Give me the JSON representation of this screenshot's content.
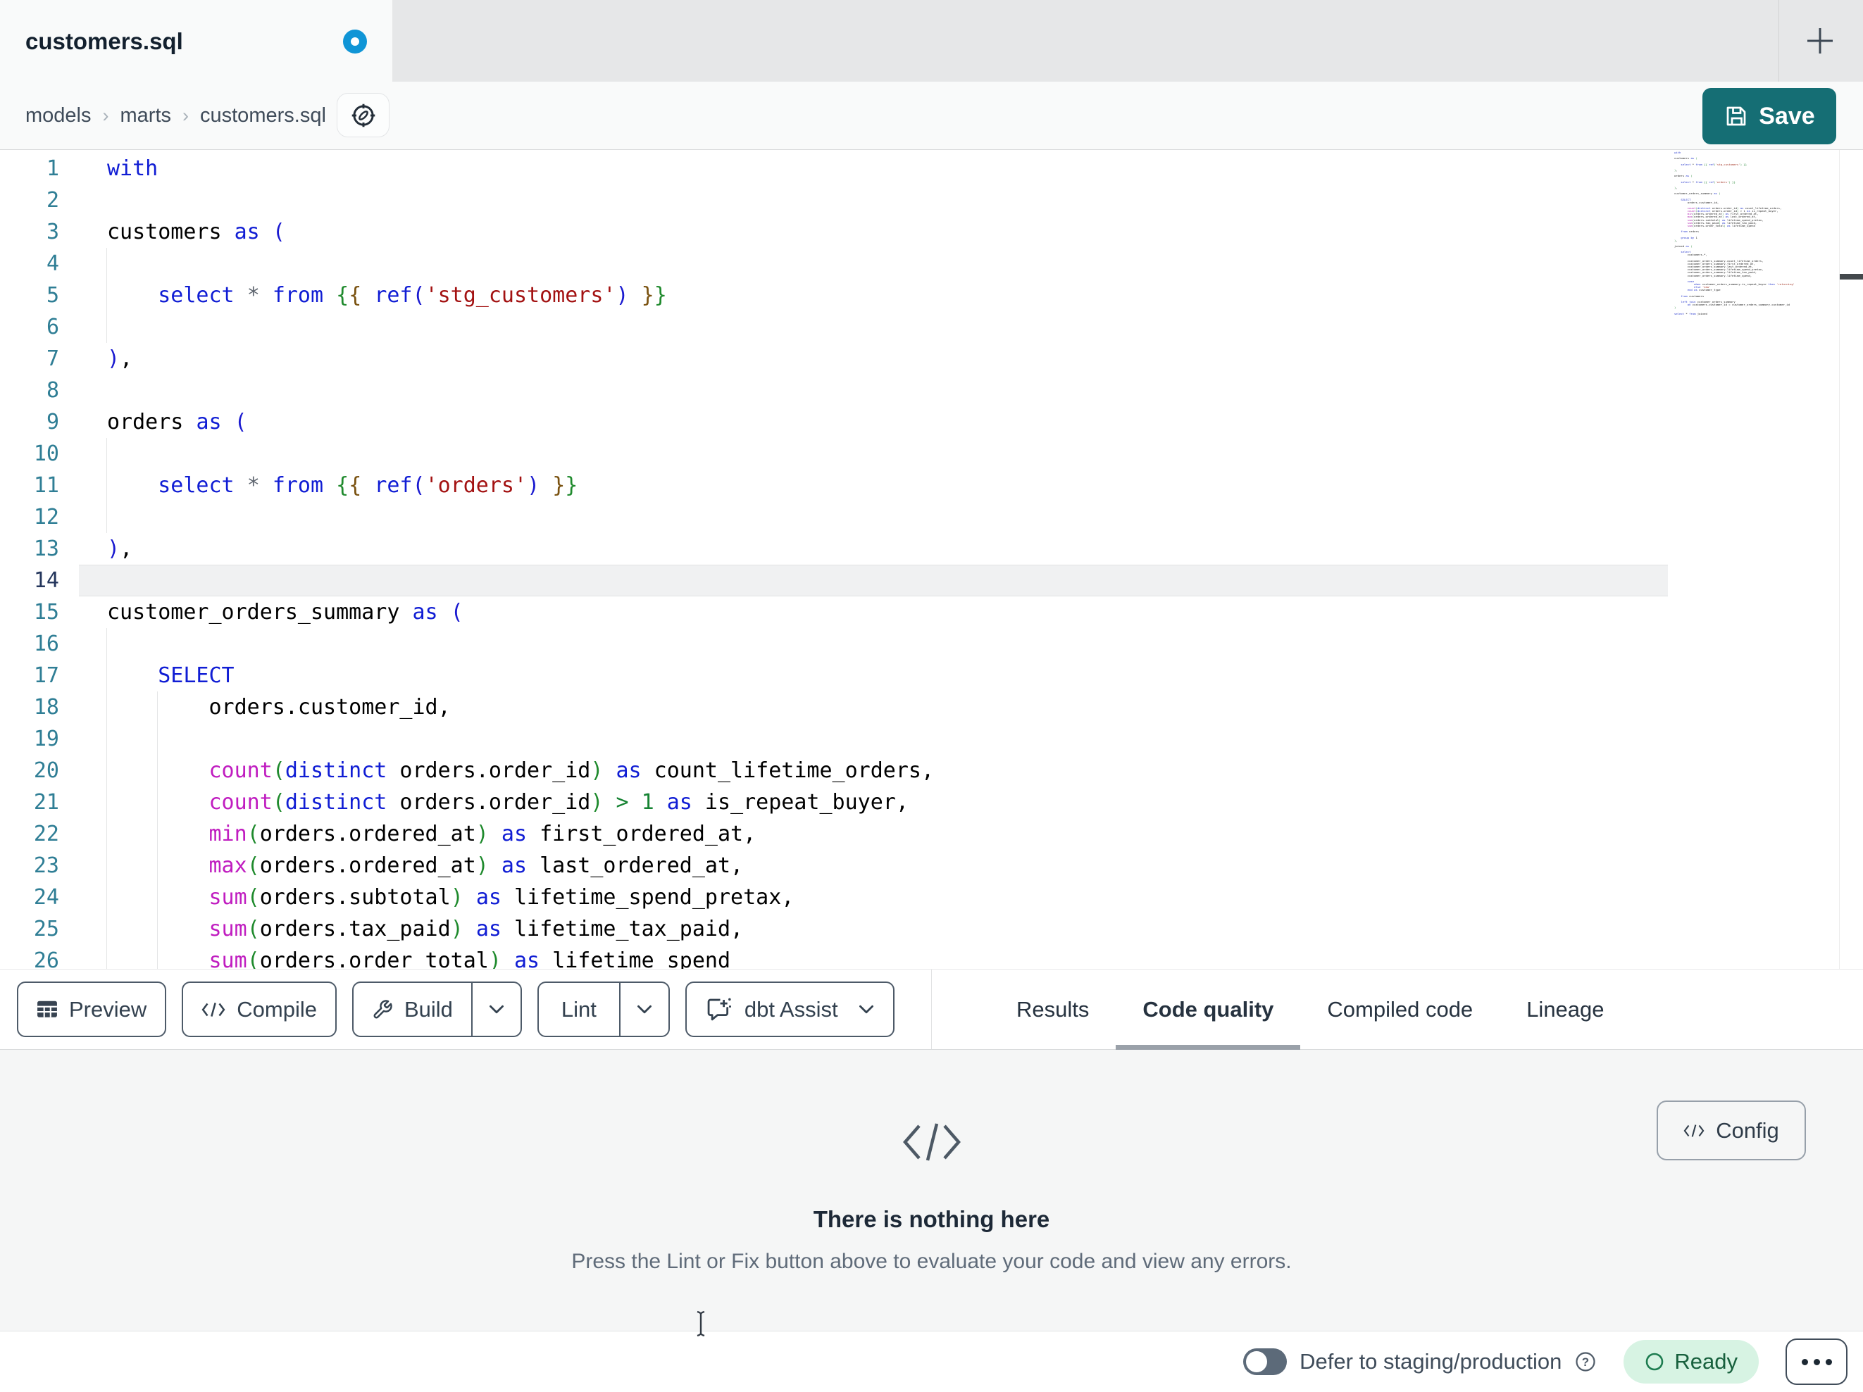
{
  "tab": {
    "title": "customers.sql",
    "dirty": true
  },
  "breadcrumb": {
    "items": [
      "models",
      "marts",
      "customers.sql"
    ],
    "separator": "›"
  },
  "actions": {
    "save": "Save"
  },
  "toolbar": {
    "preview": "Preview",
    "compile": "Compile",
    "build": "Build",
    "lint": "Lint",
    "assist": "dbt Assist"
  },
  "panel": {
    "tabs": [
      {
        "label": "Results",
        "active": false
      },
      {
        "label": "Code quality",
        "active": true
      },
      {
        "label": "Compiled code",
        "active": false
      },
      {
        "label": "Lineage",
        "active": false
      }
    ],
    "config": "Config",
    "empty": {
      "title": "There is nothing here",
      "subtitle": "Press the Lint or Fix button above to evaluate your code and view any errors."
    }
  },
  "statusbar": {
    "defer": "Defer to staging/production",
    "defer_enabled": false,
    "ready": "Ready"
  },
  "colors": {
    "teal": "#156e74",
    "dot_blue": "#1095d6",
    "ready_bg": "#d7f3e3",
    "ready_fg": "#17603d",
    "panel_bg": "#f5f6f6"
  },
  "editor": {
    "active_line": 14,
    "lines": [
      {
        "n": 1,
        "g": [],
        "t": [
          [
            "with",
            "kw"
          ]
        ]
      },
      {
        "n": 2,
        "g": [],
        "t": []
      },
      {
        "n": 3,
        "g": [],
        "t": [
          [
            "customers ",
            "tx"
          ],
          [
            "as",
            "kw"
          ],
          [
            " ",
            "tx"
          ],
          [
            "(",
            "b3"
          ]
        ]
      },
      {
        "n": 4,
        "g": [
          0
        ],
        "t": []
      },
      {
        "n": 5,
        "g": [
          0
        ],
        "t": [
          [
            "    ",
            "tx"
          ],
          [
            "select",
            "kw"
          ],
          [
            " ",
            "tx"
          ],
          [
            "*",
            "op"
          ],
          [
            " ",
            "tx"
          ],
          [
            "from",
            "kw"
          ],
          [
            " ",
            "tx"
          ],
          [
            "{",
            "b1"
          ],
          [
            "{",
            "b2"
          ],
          [
            " ",
            "tx"
          ],
          [
            "ref",
            "kw"
          ],
          [
            "(",
            "b3"
          ],
          [
            "'stg_customers'",
            "str"
          ],
          [
            ")",
            "b3"
          ],
          [
            " ",
            "tx"
          ],
          [
            "}",
            "b2"
          ],
          [
            "}",
            "b1"
          ]
        ]
      },
      {
        "n": 6,
        "g": [
          0
        ],
        "t": []
      },
      {
        "n": 7,
        "g": [],
        "t": [
          [
            ")",
            "b3"
          ],
          [
            ",",
            "tx"
          ]
        ]
      },
      {
        "n": 8,
        "g": [],
        "t": []
      },
      {
        "n": 9,
        "g": [],
        "t": [
          [
            "orders ",
            "tx"
          ],
          [
            "as",
            "kw"
          ],
          [
            " ",
            "tx"
          ],
          [
            "(",
            "b3"
          ]
        ]
      },
      {
        "n": 10,
        "g": [
          0
        ],
        "t": []
      },
      {
        "n": 11,
        "g": [
          0
        ],
        "t": [
          [
            "    ",
            "tx"
          ],
          [
            "select",
            "kw"
          ],
          [
            " ",
            "tx"
          ],
          [
            "*",
            "op"
          ],
          [
            " ",
            "tx"
          ],
          [
            "from",
            "kw"
          ],
          [
            " ",
            "tx"
          ],
          [
            "{",
            "b1"
          ],
          [
            "{",
            "b2"
          ],
          [
            " ",
            "tx"
          ],
          [
            "ref",
            "kw"
          ],
          [
            "(",
            "b3"
          ],
          [
            "'orders'",
            "str"
          ],
          [
            ")",
            "b3"
          ],
          [
            " ",
            "tx"
          ],
          [
            "}",
            "b2"
          ],
          [
            "}",
            "b1"
          ]
        ]
      },
      {
        "n": 12,
        "g": [
          0
        ],
        "t": []
      },
      {
        "n": 13,
        "g": [],
        "t": [
          [
            ")",
            "b3"
          ],
          [
            ",",
            "tx"
          ]
        ]
      },
      {
        "n": 14,
        "g": [],
        "t": [],
        "a": true
      },
      {
        "n": 15,
        "g": [],
        "t": [
          [
            "customer_orders_summary ",
            "tx"
          ],
          [
            "as",
            "kw"
          ],
          [
            " ",
            "tx"
          ],
          [
            "(",
            "b3"
          ]
        ]
      },
      {
        "n": 16,
        "g": [
          0
        ],
        "t": []
      },
      {
        "n": 17,
        "g": [
          0
        ],
        "t": [
          [
            "    ",
            "tx"
          ],
          [
            "SELECT",
            "kw"
          ]
        ]
      },
      {
        "n": 18,
        "g": [
          0,
          1
        ],
        "t": [
          [
            "        orders.customer_id,",
            "tx"
          ]
        ]
      },
      {
        "n": 19,
        "g": [
          0,
          1
        ],
        "t": []
      },
      {
        "n": 20,
        "g": [
          0,
          1
        ],
        "t": [
          [
            "        ",
            "tx"
          ],
          [
            "count",
            "fn"
          ],
          [
            "(",
            "b1"
          ],
          [
            "distinct",
            "kw"
          ],
          [
            " orders.order_id",
            "tx"
          ],
          [
            ")",
            "b1"
          ],
          [
            " ",
            "tx"
          ],
          [
            "as",
            "kw"
          ],
          [
            " count_lifetime_orders,",
            "tx"
          ]
        ]
      },
      {
        "n": 21,
        "g": [
          0,
          1
        ],
        "t": [
          [
            "        ",
            "tx"
          ],
          [
            "count",
            "fn"
          ],
          [
            "(",
            "b1"
          ],
          [
            "distinct",
            "kw"
          ],
          [
            " orders.order_id",
            "tx"
          ],
          [
            ")",
            "b1"
          ],
          [
            " ",
            "tx"
          ],
          [
            ">",
            "num"
          ],
          [
            " ",
            "tx"
          ],
          [
            "1",
            "num"
          ],
          [
            " ",
            "tx"
          ],
          [
            "as",
            "kw"
          ],
          [
            " is_repeat_buyer,",
            "tx"
          ]
        ]
      },
      {
        "n": 22,
        "g": [
          0,
          1
        ],
        "t": [
          [
            "        ",
            "tx"
          ],
          [
            "min",
            "fn"
          ],
          [
            "(",
            "b1"
          ],
          [
            "orders.ordered_at",
            "tx"
          ],
          [
            ")",
            "b1"
          ],
          [
            " ",
            "tx"
          ],
          [
            "as",
            "kw"
          ],
          [
            " first_ordered_at,",
            "tx"
          ]
        ]
      },
      {
        "n": 23,
        "g": [
          0,
          1
        ],
        "t": [
          [
            "        ",
            "tx"
          ],
          [
            "max",
            "fn"
          ],
          [
            "(",
            "b1"
          ],
          [
            "orders.ordered_at",
            "tx"
          ],
          [
            ")",
            "b1"
          ],
          [
            " ",
            "tx"
          ],
          [
            "as",
            "kw"
          ],
          [
            " last_ordered_at,",
            "tx"
          ]
        ]
      },
      {
        "n": 24,
        "g": [
          0,
          1
        ],
        "t": [
          [
            "        ",
            "tx"
          ],
          [
            "sum",
            "fn"
          ],
          [
            "(",
            "b1"
          ],
          [
            "orders.subtotal",
            "tx"
          ],
          [
            ")",
            "b1"
          ],
          [
            " ",
            "tx"
          ],
          [
            "as",
            "kw"
          ],
          [
            " lifetime_spend_pretax,",
            "tx"
          ]
        ]
      },
      {
        "n": 25,
        "g": [
          0,
          1
        ],
        "t": [
          [
            "        ",
            "tx"
          ],
          [
            "sum",
            "fn"
          ],
          [
            "(",
            "b1"
          ],
          [
            "orders.tax_paid",
            "tx"
          ],
          [
            ")",
            "b1"
          ],
          [
            " ",
            "tx"
          ],
          [
            "as",
            "kw"
          ],
          [
            " lifetime_tax_paid,",
            "tx"
          ]
        ]
      },
      {
        "n": 26,
        "g": [
          0,
          1
        ],
        "t": [
          [
            "        ",
            "tx"
          ],
          [
            "sum",
            "fn"
          ],
          [
            "(",
            "b1"
          ],
          [
            "orders.order_total",
            "tx"
          ],
          [
            ")",
            "b1"
          ],
          [
            " ",
            "tx"
          ],
          [
            "as",
            "kw"
          ],
          [
            " lifetime_spend",
            "tx"
          ]
        ]
      }
    ],
    "minimap_code": [
      "with",
      "",
      "customers as (",
      "",
      "    select * from {{ ref('stg_customers') }}",
      "",
      "),",
      "",
      "orders as (",
      "",
      "    select * from {{ ref('orders') }}",
      "",
      "),",
      "",
      "customer_orders_summary as (",
      "",
      "    SELECT",
      "        orders.customer_id,",
      "",
      "        count(distinct orders.order_id) as count_lifetime_orders,",
      "        count(distinct orders.order_id) > 1 as is_repeat_buyer,",
      "        min(orders.ordered_at) as first_ordered_at,",
      "        max(orders.ordered_at) as last_ordered_at,",
      "        sum(orders.subtotal) as lifetime_spend_pretax,",
      "        sum(orders.tax_paid) as lifetime_tax_paid,",
      "        sum(orders.order_total) as lifetime_spend",
      "",
      "    from orders",
      "",
      "    group by 1",
      "),",
      "",
      "joined as (",
      "",
      "    select",
      "        customers.*,",
      "",
      "        customer_orders_summary.count_lifetime_orders,",
      "        customer_orders_summary.first_ordered_at,",
      "        customer_orders_summary.last_ordered_at,",
      "        customer_orders_summary.lifetime_spend_pretax,",
      "        customer_orders_summary.lifetime_tax_paid,",
      "        customer_orders_summary.lifetime_spend,",
      "",
      "        case",
      "            when customer_orders_summary.is_repeat_buyer then 'returning'",
      "            else 'new'",
      "        end as customer_type",
      "",
      "    from customers",
      "",
      "    left join customer_orders_summary",
      "        on customers.customer_id = customer_orders_summary.customer_id",
      ")",
      "",
      "select * from joined"
    ]
  }
}
